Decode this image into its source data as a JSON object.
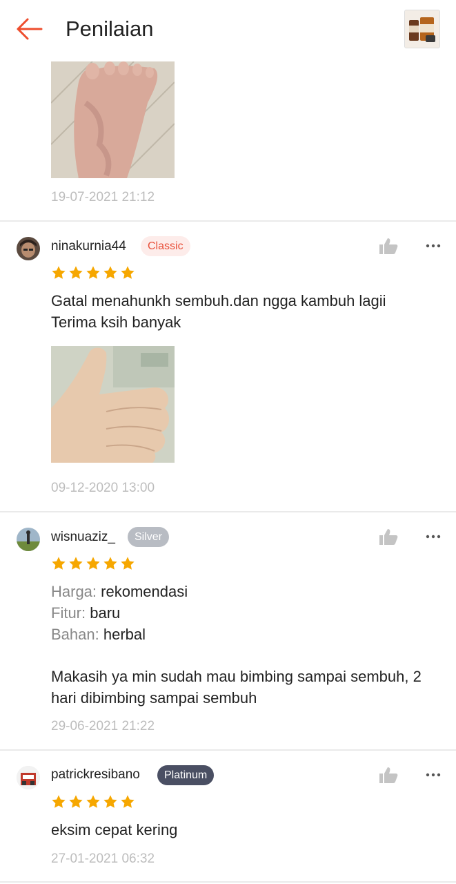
{
  "header": {
    "title": "Penilaian",
    "back_icon": "arrow-left-icon",
    "accent": "#ee4d2d"
  },
  "reviews": [
    {
      "date": "19-07-2021 21:12"
    },
    {
      "username": "ninakurnia44",
      "badge": "Classic",
      "rating": 5,
      "text_line1": "Gatal menahunkh sembuh.dan ngga kambuh lagii",
      "text_line2": "Terima ksih banyak",
      "date": "09-12-2020 13:00"
    },
    {
      "username": "wisnuaziz_",
      "badge": "Silver",
      "rating": 5,
      "attrs": [
        {
          "label": "Harga:",
          "value": "rekomendasi"
        },
        {
          "label": "Fitur:",
          "value": "baru"
        },
        {
          "label": "Bahan:",
          "value": "herbal"
        }
      ],
      "text_line1": "Makasih ya min sudah mau bimbing sampai sembuh, 2",
      "text_line2": "hari dibimbing sampai sembuh",
      "date": "29-06-2021 21:22"
    },
    {
      "username": "patrickresibano",
      "badge": "Platinum",
      "rating": 5,
      "text_line1": "eksim cepat kering",
      "date": "27-01-2021 06:32"
    }
  ],
  "colors": {
    "star": "#f6a700",
    "date": "#bdbdbd",
    "like_icon": "#c4c4c4"
  }
}
